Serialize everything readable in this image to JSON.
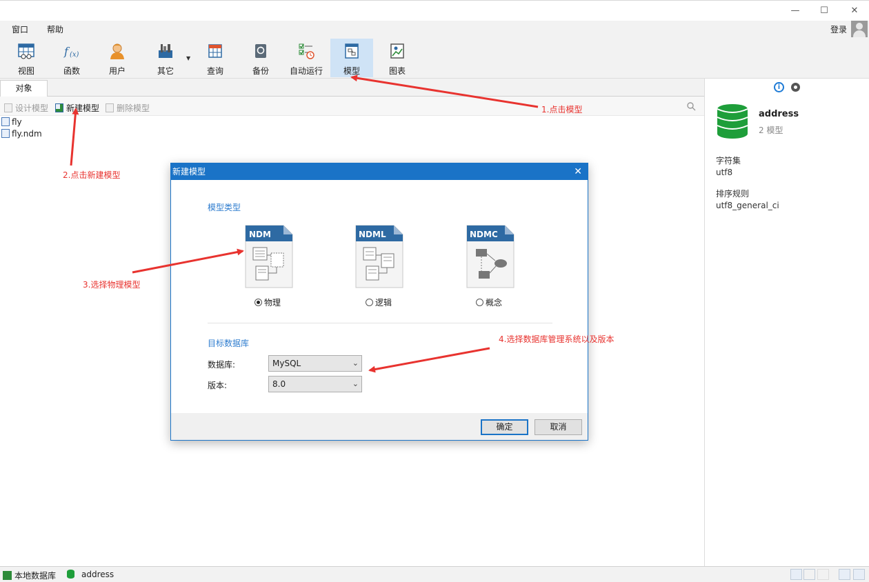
{
  "window": {
    "minimize": "—",
    "maximize": "☐",
    "close": "✕"
  },
  "menu": {
    "items": [
      "窗口",
      "帮助"
    ],
    "login": "登录"
  },
  "toolbar": {
    "tools": [
      "视图",
      "函数",
      "用户",
      "其它",
      "查询",
      "备份",
      "自动运行",
      "模型",
      "图表"
    ],
    "active": "模型"
  },
  "object_panel": {
    "tab": "对象",
    "actions": {
      "design": "设计模型",
      "new": "新建模型",
      "delete": "删除模型"
    },
    "files": [
      "fly",
      "fly.ndm"
    ]
  },
  "right_panel": {
    "name": "address",
    "sub": "2 模型",
    "charset_label": "字符集",
    "charset_value": "utf8",
    "collation_label": "排序规则",
    "collation_value": "utf8_general_ci"
  },
  "status_bar": {
    "connection": "本地数据库",
    "database": "address"
  },
  "dialog": {
    "title": "新建模型",
    "close": "✕",
    "model_type_title": "模型类型",
    "models": [
      {
        "tag": "NDM",
        "label": "物理",
        "selected": true
      },
      {
        "tag": "NDML",
        "label": "逻辑",
        "selected": false
      },
      {
        "tag": "NDMC",
        "label": "概念",
        "selected": false
      }
    ],
    "target_db_title": "目标数据库",
    "db_label": "数据库:",
    "db_value": "MySQL",
    "version_label": "版本:",
    "version_value": "8.0",
    "ok": "确定",
    "cancel": "取消"
  },
  "annotations": {
    "step1": "1.点击模型",
    "step2": "2.点击新建模型",
    "step3": "3.选择物理模型",
    "step4": "4.选择数据库管理系统以及版本"
  },
  "colors": {
    "accent": "#1a73c7",
    "annotation": "#e8332f",
    "database": "#1e9e3a",
    "card": "#2e6aa3"
  }
}
